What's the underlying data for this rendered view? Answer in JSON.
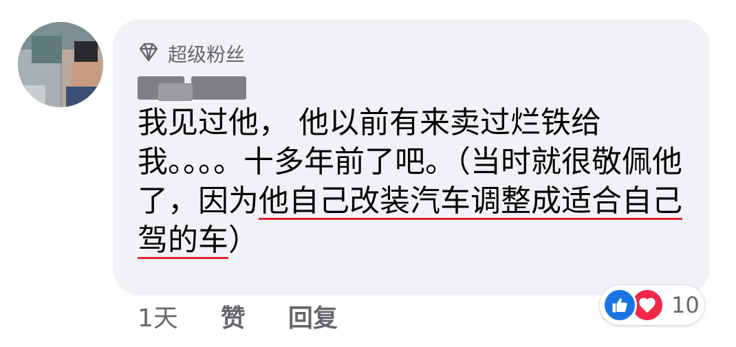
{
  "colors": {
    "bubble": "#f0f2f5",
    "text": "#050505",
    "secondary": "#65676b",
    "underline": "#e02531",
    "like": "#1b74e4",
    "love": "#f0284a"
  },
  "comment": {
    "badge_icon": "diamond-icon",
    "badge_label": "超级粉丝",
    "author_name_blurred": true,
    "text_before": "我见过他， 他以前有来卖过烂铁给我。。。。十多年前了吧。（当时就很敬佩他了，因为",
    "text_underlined": "他自己改装汽车调整成适合自己驾的车",
    "text_after": "）"
  },
  "actions": {
    "time": "1天",
    "like_label": "赞",
    "reply_label": "回复"
  },
  "reactions": {
    "icons": [
      "like-icon",
      "love-icon"
    ],
    "count": "10"
  }
}
